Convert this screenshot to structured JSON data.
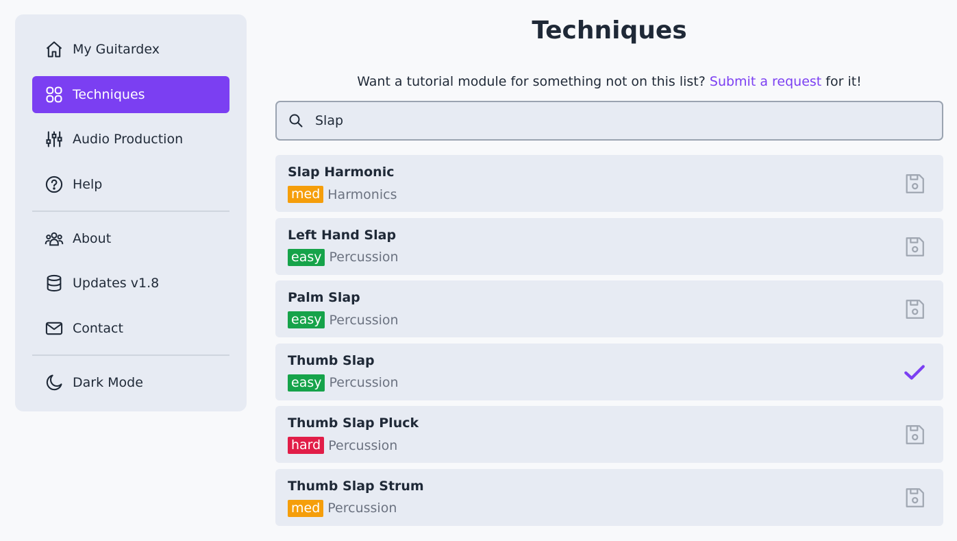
{
  "sidebar": {
    "items": [
      {
        "label": "My Guitardex",
        "icon": "home-icon"
      },
      {
        "label": "Techniques",
        "icon": "grid-icon",
        "active": true
      },
      {
        "label": "Audio Production",
        "icon": "sliders-icon"
      },
      {
        "label": "Help",
        "icon": "help-circle-icon"
      },
      {
        "label": "About",
        "icon": "users-icon"
      },
      {
        "label": "Updates v1.8",
        "icon": "database-icon"
      },
      {
        "label": "Contact",
        "icon": "mail-icon"
      },
      {
        "label": "Dark Mode",
        "icon": "moon-icon"
      }
    ]
  },
  "main": {
    "title": "Techniques",
    "request_prefix": "Want a tutorial module for something not on this list? ",
    "request_link": "Submit a request",
    "request_suffix": " for it!",
    "search": {
      "value": "Slap",
      "icon": "search-icon"
    },
    "techniques": [
      {
        "name": "Slap Harmonic",
        "difficulty": "med",
        "category": "Harmonics",
        "status": "save"
      },
      {
        "name": "Left Hand Slap",
        "difficulty": "easy",
        "category": "Percussion",
        "status": "save"
      },
      {
        "name": "Palm Slap",
        "difficulty": "easy",
        "category": "Percussion",
        "status": "save"
      },
      {
        "name": "Thumb Slap",
        "difficulty": "easy",
        "category": "Percussion",
        "status": "saved"
      },
      {
        "name": "Thumb Slap Pluck",
        "difficulty": "hard",
        "category": "Percussion",
        "status": "save"
      },
      {
        "name": "Thumb Slap Strum",
        "difficulty": "med",
        "category": "Percussion",
        "status": "save"
      }
    ]
  },
  "colors": {
    "accent": "#7b3ff2",
    "panel": "#e7ebf3",
    "background": "#f8f9fb",
    "med": "#f59e0b",
    "easy": "#16a34a",
    "hard": "#e11d48"
  }
}
